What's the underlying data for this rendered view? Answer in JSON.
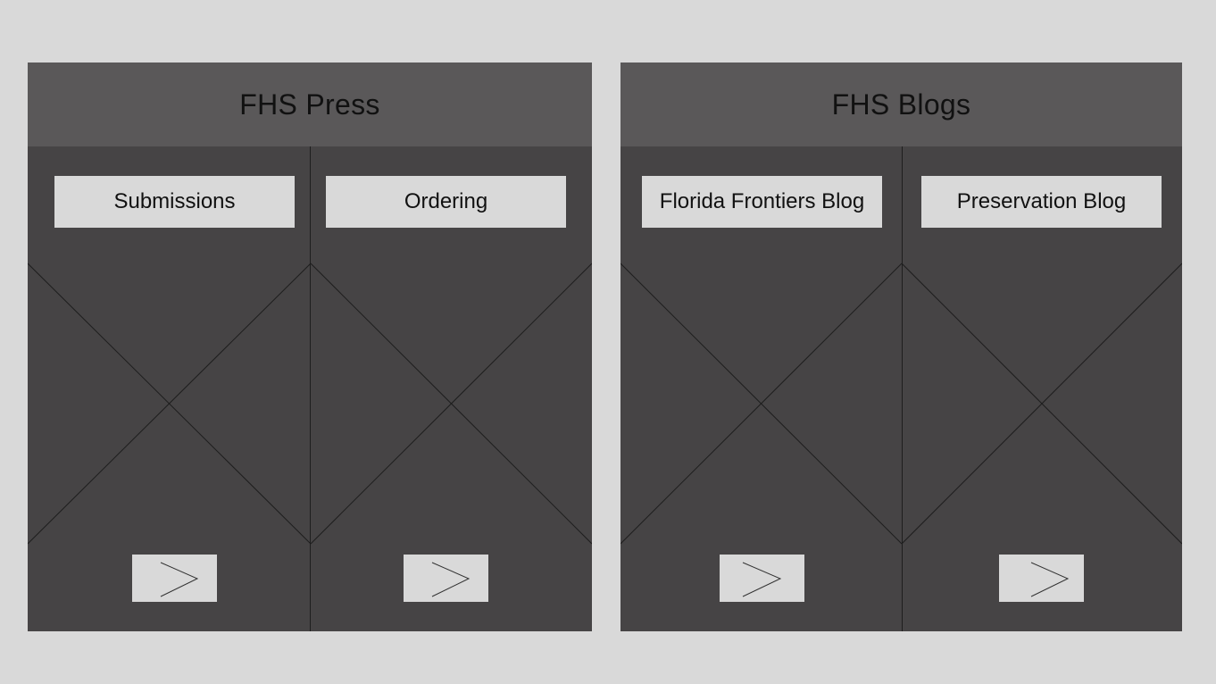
{
  "panels": [
    {
      "title": "FHS Press",
      "items": [
        {
          "label": "Submissions",
          "arrow_icon": "chevron-right-icon"
        },
        {
          "label": "Ordering",
          "arrow_icon": "chevron-right-icon"
        }
      ]
    },
    {
      "title": "FHS Blogs",
      "items": [
        {
          "label": "Florida Frontiers Blog",
          "arrow_icon": "chevron-right-icon"
        },
        {
          "label": "Preservation Blog",
          "arrow_icon": "chevron-right-icon"
        }
      ]
    }
  ],
  "colors": {
    "page_background": "#d9d9d9",
    "panel_body": "#464445",
    "panel_header": "#5a5859",
    "button_fill": "#d9d9d9",
    "line_color": "#1e1e1e"
  }
}
